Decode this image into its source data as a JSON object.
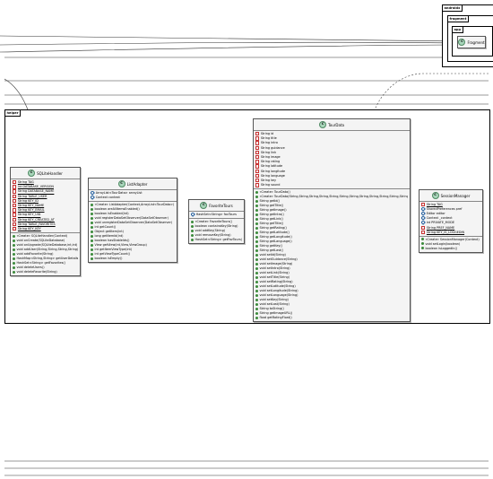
{
  "packages": {
    "androidx": "androidx",
    "fragment": "fragment",
    "app": "app",
    "helper": "helper"
  },
  "fragment_class": {
    "name": "Fragment",
    "badge": "C"
  },
  "classes": {
    "sqlite": {
      "name": "SQLiteHandler",
      "badge": "C",
      "fields": [
        {
          "v": "priv",
          "t": "String TAG",
          "s": true
        },
        {
          "v": "priv",
          "t": "int DATABASE_VERSION",
          "s": true
        },
        {
          "v": "priv",
          "t": "String DATABASE_NAME",
          "s": true
        },
        {
          "v": "priv",
          "t": "String TABLE_USER",
          "s": true
        },
        {
          "v": "priv",
          "t": "String KEY_ID",
          "s": true
        },
        {
          "v": "priv",
          "t": "String KEY_NAME",
          "s": true
        },
        {
          "v": "priv",
          "t": "String KEY_EMAIL",
          "s": true
        },
        {
          "v": "priv",
          "t": "String KEY_UID",
          "s": true
        },
        {
          "v": "priv",
          "t": "String KEY_CREATED_AT",
          "s": true
        },
        {
          "v": "priv",
          "t": "String TABLE_FAVORITES",
          "s": true
        },
        {
          "v": "priv",
          "t": "String KEY_KEY",
          "s": true
        }
      ],
      "methods": [
        {
          "v": "pub",
          "t": "«Create» SQLiteHandler(Context)"
        },
        {
          "v": "pub",
          "t": "void onCreate(SQLiteDatabase)"
        },
        {
          "v": "pub",
          "t": "void onUpgrade(SQLiteDatabase,int,int)"
        },
        {
          "v": "pub",
          "t": "void addUser(String,String,String,String)"
        },
        {
          "v": "pub",
          "t": "void addFavorite(String)"
        },
        {
          "v": "pub",
          "t": "HashMap<String,String> getUserDetails()"
        },
        {
          "v": "pub",
          "t": "HashSet<String> getFavorites()"
        },
        {
          "v": "pub",
          "t": "void deleteUsers()"
        },
        {
          "v": "pub",
          "t": "void deleteFavorite(String)"
        }
      ]
    },
    "list": {
      "name": "ListAdapter",
      "badge": "C",
      "fields": [
        {
          "v": "pkg",
          "t": "ArrayList<TourData> arrayList"
        },
        {
          "v": "pkg",
          "t": "Context context"
        }
      ],
      "methods": [
        {
          "v": "pub",
          "t": "«Create» ListAdapter(Context,ArrayList<TourData>)"
        },
        {
          "v": "pub",
          "t": "boolean areAllItemsEnabled()"
        },
        {
          "v": "pub",
          "t": "boolean isEnabled(int)"
        },
        {
          "v": "pub",
          "t": "void registerDataSetObserver(DataSetObserver)"
        },
        {
          "v": "pub",
          "t": "void unregisterDataSetObserver(DataSetObserver)"
        },
        {
          "v": "pub",
          "t": "int getCount()"
        },
        {
          "v": "pub",
          "t": "Object getItem(int)"
        },
        {
          "v": "pub",
          "t": "long getItemId(int)"
        },
        {
          "v": "pub",
          "t": "boolean hasStableIds()"
        },
        {
          "v": "pub",
          "t": "View getView(int,View,ViewGroup)"
        },
        {
          "v": "pub",
          "t": "int getItemViewType(int)"
        },
        {
          "v": "pub",
          "t": "int getViewTypeCount()"
        },
        {
          "v": "pub",
          "t": "boolean isEmpty()"
        }
      ]
    },
    "fav": {
      "name": "FavoriteTours",
      "badge": "C",
      "fields": [
        {
          "v": "pkg",
          "t": "HashSet<String> favTours"
        }
      ],
      "methods": [
        {
          "v": "pub",
          "t": "«Create» FavoriteTours()"
        },
        {
          "v": "pub",
          "t": "boolean containsKey(String)"
        },
        {
          "v": "pub",
          "t": "void addKey(String)"
        },
        {
          "v": "pub",
          "t": "void removeKey(String)"
        },
        {
          "v": "pub",
          "t": "HashSet<String> getFavTours()"
        }
      ]
    },
    "tour": {
      "name": "TourData",
      "badge": "C",
      "fields": [
        {
          "v": "priv",
          "t": "String id"
        },
        {
          "v": "priv",
          "t": "String title"
        },
        {
          "v": "priv",
          "t": "String intro"
        },
        {
          "v": "priv",
          "t": "String guidance"
        },
        {
          "v": "priv",
          "t": "String link"
        },
        {
          "v": "priv",
          "t": "String image"
        },
        {
          "v": "priv",
          "t": "String rating"
        },
        {
          "v": "priv",
          "t": "String latitude"
        },
        {
          "v": "priv",
          "t": "String longitude"
        },
        {
          "v": "priv",
          "t": "String language"
        },
        {
          "v": "priv",
          "t": "String key"
        },
        {
          "v": "priv",
          "t": "String sound"
        }
      ],
      "methods": [
        {
          "v": "pub",
          "t": "«Create» TourData()"
        },
        {
          "v": "pub",
          "t": "«Create» TourData(String,String,String,String,String,String,String,String,String,String,String,String)"
        },
        {
          "v": "pub",
          "t": "String getId()"
        },
        {
          "v": "pub",
          "t": "String getTitle()"
        },
        {
          "v": "pub",
          "t": "String getImage()"
        },
        {
          "v": "pub",
          "t": "String getIntro()"
        },
        {
          "v": "pub",
          "t": "String getLink()"
        },
        {
          "v": "pub",
          "t": "String getTitle()"
        },
        {
          "v": "pub",
          "t": "String getRating()"
        },
        {
          "v": "pub",
          "t": "String getLatitude()"
        },
        {
          "v": "pub",
          "t": "String getLongitude()"
        },
        {
          "v": "pub",
          "t": "String getLanguage()"
        },
        {
          "v": "pub",
          "t": "String getKey()"
        },
        {
          "v": "pub",
          "t": "String getLast()"
        },
        {
          "v": "pub",
          "t": "void setId(String)"
        },
        {
          "v": "pub",
          "t": "void setGuidance(String)"
        },
        {
          "v": "pub",
          "t": "void setImage(String)"
        },
        {
          "v": "pub",
          "t": "void setIntro(String)"
        },
        {
          "v": "pub",
          "t": "void setLink(String)"
        },
        {
          "v": "pub",
          "t": "void setTitle(String)"
        },
        {
          "v": "pub",
          "t": "void setRating(String)"
        },
        {
          "v": "pub",
          "t": "void setLatitude(String)"
        },
        {
          "v": "pub",
          "t": "void setLongitude(String)"
        },
        {
          "v": "pub",
          "t": "void setLanguage(String)"
        },
        {
          "v": "pub",
          "t": "void setKey(String)"
        },
        {
          "v": "pub",
          "t": "void setLast(String)"
        },
        {
          "v": "pub",
          "t": "String toString()"
        },
        {
          "v": "pub",
          "t": "String getImageURL()"
        },
        {
          "v": "pub",
          "t": "float getRatingFloat()"
        }
      ]
    },
    "session": {
      "name": "SessionManager",
      "badge": "C",
      "fields": [
        {
          "v": "priv",
          "t": "String TAG",
          "s": true
        },
        {
          "v": "pkg",
          "t": "SharedPreferences pref"
        },
        {
          "v": "pkg",
          "t": "Editor editor"
        },
        {
          "v": "pkg",
          "t": "Context _context"
        },
        {
          "v": "pkg",
          "t": "int PRIVATE_MODE"
        },
        {
          "v": "priv",
          "t": "String PREF_NAME",
          "s": true
        },
        {
          "v": "priv",
          "t": "String KEY_IS_LOGGEDIN",
          "s": true
        }
      ],
      "methods": [
        {
          "v": "pub",
          "t": "«Create» SessionManager(Context)"
        },
        {
          "v": "pub",
          "t": "void setLogin(boolean)"
        },
        {
          "v": "pub",
          "t": "boolean isLoggedIn()"
        }
      ]
    }
  }
}
